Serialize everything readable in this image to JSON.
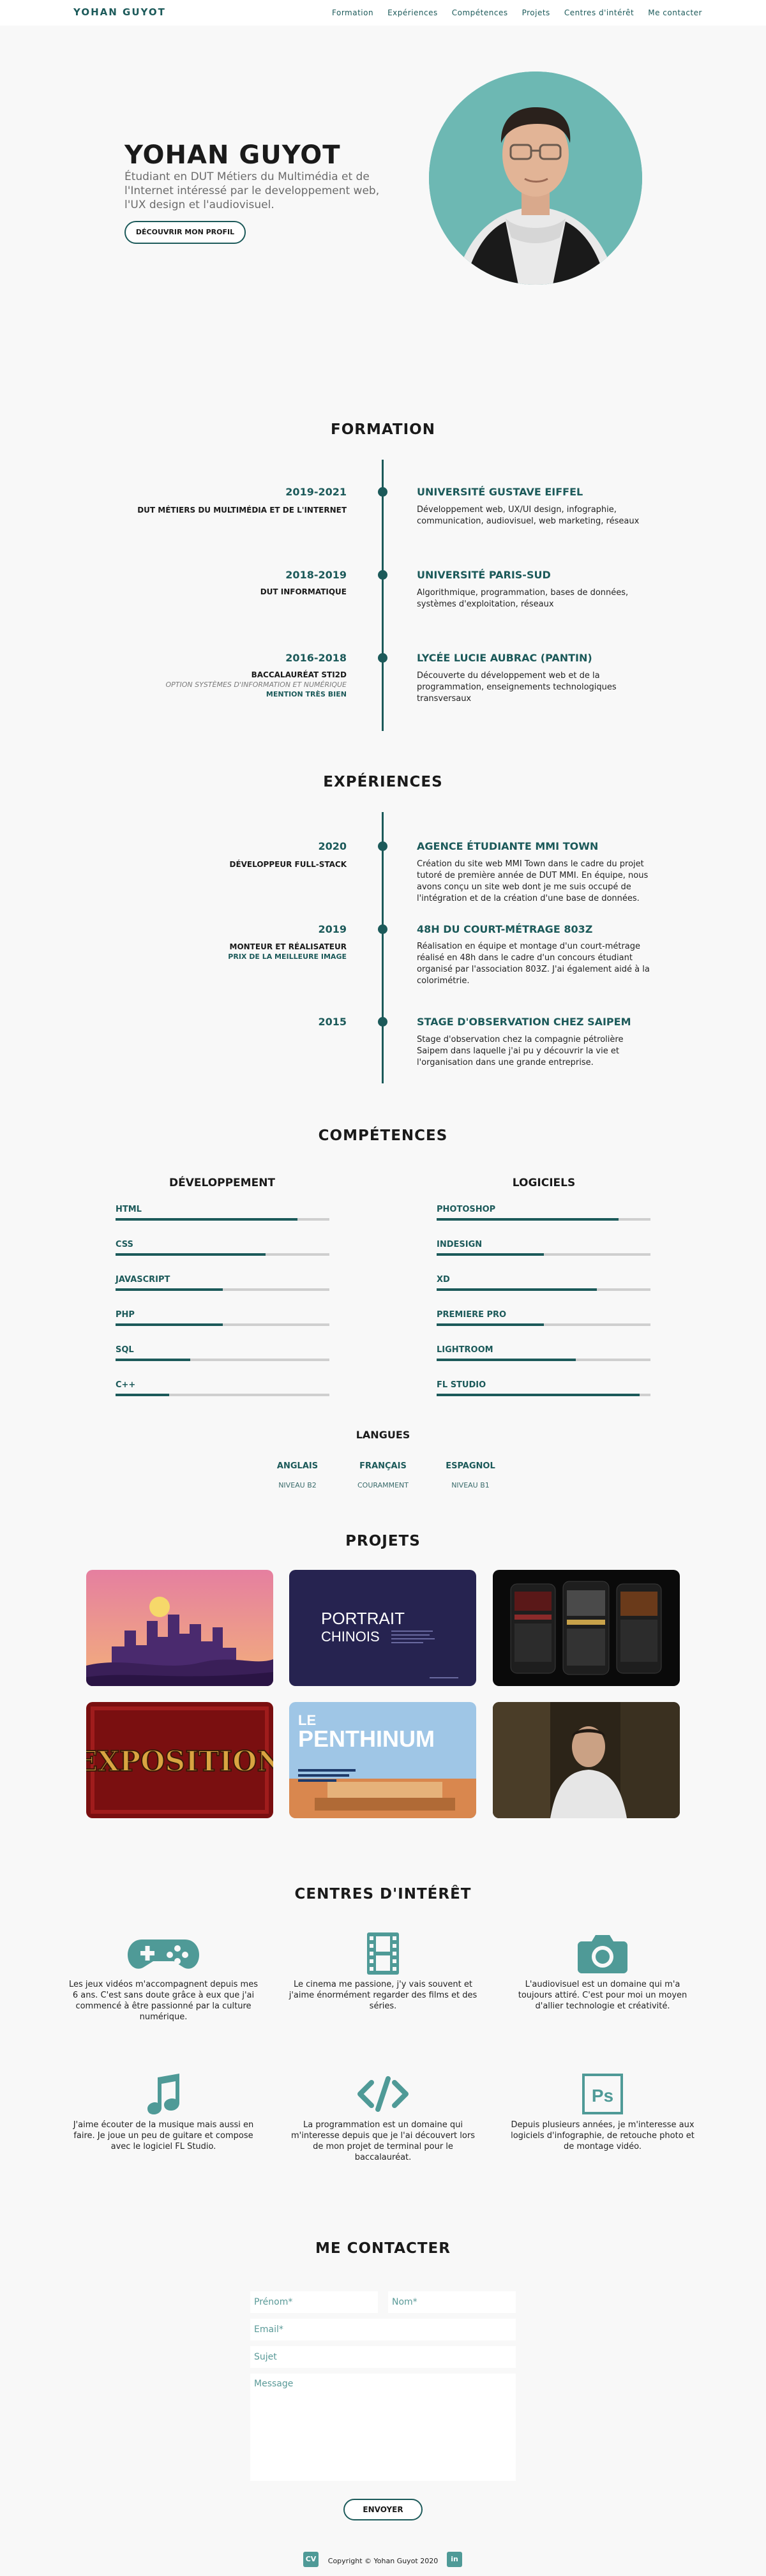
{
  "nav": {
    "logo": "YOHAN GUYOT",
    "links": [
      "Formation",
      "Expériences",
      "Compétences",
      "Projets",
      "Centres d'intérêt",
      "Me contacter"
    ]
  },
  "hero": {
    "name": "YOHAN GUYOT",
    "description": "Étudiant en DUT Métiers du Multimédia et de l'Internet intéressé par le developpement web, l'UX design et l'audiovisuel.",
    "button": "DÉCOUVRIR MON PROFIL"
  },
  "formation": {
    "title": "FORMATION",
    "items": [
      {
        "year": "2019-2021",
        "l1": "DUT MÉTIERS DU MULTIMÉDIA ET DE L'INTERNET",
        "l2": "",
        "l3": "",
        "place": "UNIVERSITÉ GUSTAVE EIFFEL",
        "desc": "Développement web, UX/UI design, infographie, communication, audiovisuel, web marketing, réseaux"
      },
      {
        "year": "2018-2019",
        "l1": "DUT INFORMATIQUE",
        "l2": "",
        "l3": "",
        "place": "UNIVERSITÉ PARIS-SUD",
        "desc": "Algorithmique, programmation, bases de données, systèmes d'exploitation, réseaux"
      },
      {
        "year": "2016-2018",
        "l1": "BACCALAURÉAT STI2D",
        "l2": "OPTION SYSTÈMES D'INFORMATION ET NUMÉRIQUE",
        "l3": "MENTION TRÈS BIEN",
        "place": "LYCÉE LUCIE AUBRAC (PANTIN)",
        "desc": "Découverte du développement web et de la programmation, enseignements technologiques transversaux"
      }
    ]
  },
  "experiences": {
    "title": "EXPÉRIENCES",
    "items": [
      {
        "year": "2020",
        "l1": "DÉVELOPPEUR FULL-STACK",
        "l3": "",
        "place": "AGENCE ÉTUDIANTE MMI TOWN",
        "desc": "Création du site web MMI Town dans le cadre du projet tutoré de première année de DUT MMI. En équipe, nous avons conçu un site web dont je me suis occupé de l'intégration et de la création d'une base de données."
      },
      {
        "year": "2019",
        "l1": "MONTEUR ET RÉALISATEUR",
        "l3": "PRIX DE LA MEILLEURE IMAGE",
        "place": "48H DU COURT-MÉTRAGE 803Z",
        "desc": "Réalisation en équipe et montage d'un court-métrage réalisé en 48h dans le cadre d'un concours étudiant organisé par l'association 803Z. J'ai également aidé à la colorimétrie."
      },
      {
        "year": "2015",
        "l1": "",
        "l3": "",
        "place": "STAGE D'OBSERVATION CHEZ SAIPEM",
        "desc": "Stage d'observation chez la compagnie pétrolière Saipem dans laquelle j'ai pu y découvrir la vie et l'organisation dans une grande entreprise."
      }
    ]
  },
  "competences": {
    "title": "COMPÉTENCES",
    "dev_title": "DÉVELOPPEMENT",
    "soft_title": "LOGICIELS",
    "dev": [
      {
        "name": "HTML",
        "level": 0.85
      },
      {
        "name": "CSS",
        "level": 0.7
      },
      {
        "name": "JAVASCRIPT",
        "level": 0.5
      },
      {
        "name": "PHP",
        "level": 0.5
      },
      {
        "name": "SQL",
        "level": 0.35
      },
      {
        "name": "C++",
        "level": 0.25
      }
    ],
    "soft": [
      {
        "name": "PHOTOSHOP",
        "level": 0.85
      },
      {
        "name": "INDESIGN",
        "level": 0.5
      },
      {
        "name": "XD",
        "level": 0.75
      },
      {
        "name": "PREMIERE PRO",
        "level": 0.5
      },
      {
        "name": "LIGHTROOM",
        "level": 0.65
      },
      {
        "name": "FL STUDIO",
        "level": 0.95
      }
    ],
    "langues_title": "LANGUES",
    "langues": [
      {
        "name": "ANGLAIS",
        "level": "NIVEAU B2"
      },
      {
        "name": "FRANÇAIS",
        "level": "COURAMMENT"
      },
      {
        "name": "ESPAGNOL",
        "level": "NIVEAU B1"
      }
    ]
  },
  "projets": {
    "title": "PROJETS",
    "portrait_line1": "PORTRAIT",
    "portrait_line2": "CHINOIS",
    "exposition": "EXPOSITION",
    "penthinum_le": "LE",
    "penthinum": "PENTHINUM"
  },
  "interets": {
    "title": "CENTRES D'INTÉRÊT",
    "items": [
      {
        "icon": "gamepad-icon",
        "text": "Les jeux vidéos m'accompagnent depuis mes 6 ans. C'est sans doute grâce à eux que j'ai commencé à être passionné par la culture numérique."
      },
      {
        "icon": "film-icon",
        "text": "Le cinema me passione, j'y vais souvent et j'aime énormément regarder des films et des séries."
      },
      {
        "icon": "camera-icon",
        "text": "L'audiovisuel est un domaine qui m'a toujours attiré. C'est pour moi un moyen d'allier technologie et créativité."
      },
      {
        "icon": "music-icon",
        "text": "J'aime écouter de la musique mais aussi en faire. Je joue un peu de guitare et compose avec le logiciel FL Studio."
      },
      {
        "icon": "code-icon",
        "text": "La programmation est un domaine qui m'interesse depuis que je l'ai découvert lors de mon projet de terminal pour le baccalauréat."
      },
      {
        "icon": "photoshop-icon",
        "text": "Depuis plusieurs années, je m'interesse aux logiciels d'infographie, de retouche photo et de montage vidéo."
      }
    ],
    "ps_label": "Ps"
  },
  "contact": {
    "title": "ME CONTACTER",
    "prenom": "Prénom*",
    "nom": "Nom*",
    "email": "Email*",
    "sujet": "Sujet",
    "message": "Message",
    "send": "ENVOYER"
  },
  "footer": {
    "copyright": "Copyright © Yohan Guyot 2020",
    "cv_label": "CV",
    "in_label": "in"
  },
  "colors": {
    "accent": "#1c5a5a",
    "icon": "#4f9a97",
    "avatar_bg": "#6db8b3",
    "background": "#f8f8f8"
  }
}
